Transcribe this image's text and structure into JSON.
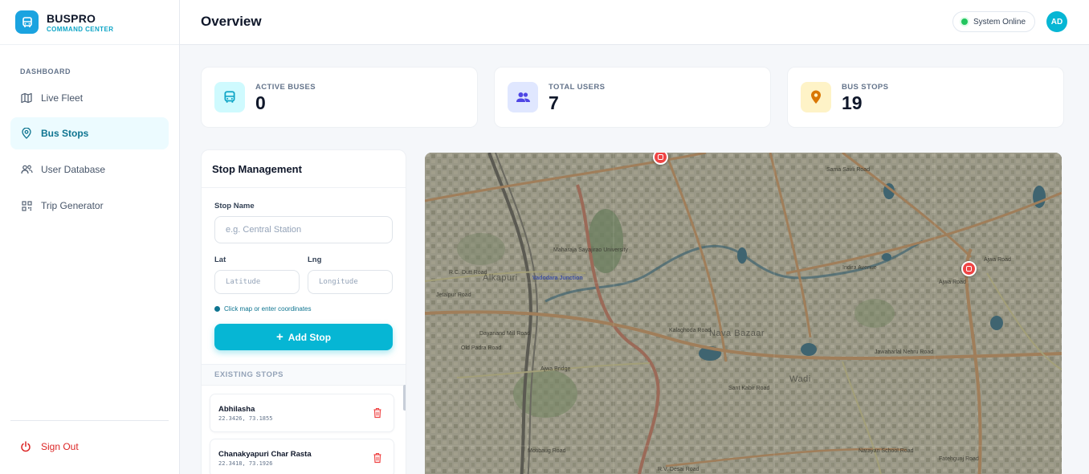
{
  "brand": {
    "name": "BUSPRO",
    "subtitle": "COMMAND CENTER"
  },
  "sidebar": {
    "heading": "DASHBOARD",
    "items": [
      {
        "label": "Live Fleet",
        "icon": "map-icon",
        "active": false
      },
      {
        "label": "Bus Stops",
        "icon": "map-pin-icon",
        "active": true
      },
      {
        "label": "User Database",
        "icon": "users-icon",
        "active": false
      },
      {
        "label": "Trip Generator",
        "icon": "qr-code-icon",
        "active": false
      }
    ],
    "sign_out": "Sign Out"
  },
  "header": {
    "title": "Overview",
    "status": "System Online",
    "avatar": "AD"
  },
  "stats": [
    {
      "label": "ACTIVE BUSES",
      "value": "0",
      "icon": "bus-icon",
      "color": "#0ea5c6",
      "bg": "#cffafe"
    },
    {
      "label": "TOTAL USERS",
      "value": "7",
      "icon": "users-icon",
      "color": "#4f46e5",
      "bg": "#e0e7ff"
    },
    {
      "label": "BUS STOPS",
      "value": "19",
      "icon": "map-pin-icon",
      "color": "#d97706",
      "bg": "#fef3c7"
    }
  ],
  "stop_management": {
    "title": "Stop Management",
    "stop_name_label": "Stop Name",
    "stop_name_placeholder": "e.g. Central Station",
    "lat_label": "Lat",
    "lat_placeholder": "Latitude",
    "lng_label": "Lng",
    "lng_placeholder": "Longitude",
    "hint": "Click map or enter coordinates",
    "add_button": "Add Stop",
    "existing_heading": "EXISTING STOPS",
    "stops": [
      {
        "name": "Abhilasha",
        "coords": "22.3426, 73.1855"
      },
      {
        "name": "Chanakyapuri Char Rasta",
        "coords": "22.3418, 73.1926"
      }
    ]
  },
  "map": {
    "labels": {
      "alkapuri": "Alkapuri",
      "vadodara_junction": "Vadodara Junction",
      "rc_dutt": "R.C. Dutt Road",
      "jetalpur": "Jetalpur Road",
      "old_padra": "Old Padra Road",
      "dayanand": "Dayanand Mill Road",
      "nava_bazaar": "Nava Bazaar",
      "wadi": "Wadi",
      "kalaghoda": "Kalaghoda Road",
      "jawaharlal": "Jawaharlal Nehru Road",
      "indira": "Indira Avenue",
      "ajwa": "Ajwa Road",
      "sant_kabir": "Sant Kabir Road",
      "narayan": "Narayan School Road",
      "moti_baug": "Motibaug Road",
      "rv_desai": "R.V. Desai Road",
      "ajwa_bridge": "Ajwa Bridge",
      "sama_savli": "Sama Savli Road",
      "maharaja": "Maharaja Sayajirao University",
      "ajwa2": "Ajwa Road",
      "fatehgunj": "Fatehgunj Road"
    }
  }
}
